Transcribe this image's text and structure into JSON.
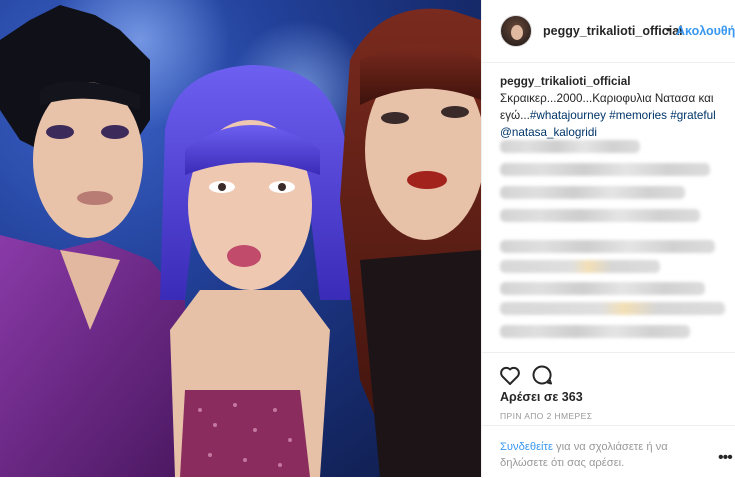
{
  "header": {
    "username": "peggy_trikalioti_official",
    "separator": "•",
    "follow_label": "Ακολουθήστε"
  },
  "caption": {
    "author": "peggy_trikalioti_official",
    "text": "Σκραικερ...2000...Καριοφυλια Νατασα και εγώ...",
    "hashtags": [
      "#whatajourney",
      "#memories",
      "#grateful"
    ],
    "mention": "@natasa_kalogridi"
  },
  "actions": {
    "like_icon": "heart-icon",
    "comment_icon": "comment-icon"
  },
  "likes": "Αρέσει σε 363",
  "timestamp": "ΠΡΙΝ ΑΠΟ 2 ΗΜΕΡΕΣ",
  "comment_prompt": {
    "login_link": "Συνδεθείτε",
    "rest": " για να σχολιάσετε ή να δηλώσετε ότι σας αρέσει."
  },
  "more_icon": "ellipsis-icon",
  "colors": {
    "link_blue": "#3897f0",
    "hashtag_blue": "#003569",
    "muted_gray": "#999999",
    "border": "#efefef"
  }
}
